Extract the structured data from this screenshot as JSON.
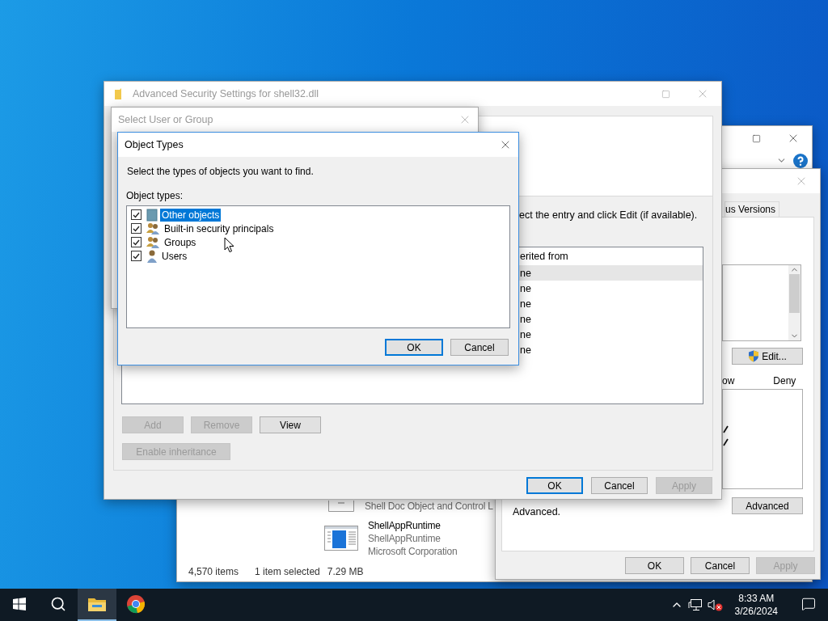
{
  "explorer": {
    "files": [
      {
        "description": "Shell Doc Object and Control L"
      },
      {
        "name": "ShellAppRuntime",
        "description": "ShellAppRuntime",
        "company": "Microsoft Corporation"
      }
    ],
    "status": {
      "count": "4,570 items",
      "selection": "1 item selected",
      "size": "7.29 MB"
    }
  },
  "properties": {
    "tabs": [
      {
        "label": "us Versions",
        "selected": false
      }
    ],
    "edit_button": "Edit...",
    "columns": [
      "ow",
      "Deny"
    ],
    "permissions": [
      {
        "checked": true
      },
      {
        "checked": true
      }
    ],
    "note": "Advanced.",
    "advanced_button": "Advanced",
    "buttons": [
      {
        "label": "OK",
        "disabled": false
      },
      {
        "label": "Cancel",
        "disabled": false
      },
      {
        "label": "Apply",
        "disabled": true
      }
    ]
  },
  "security_settings": {
    "title": "Advanced Security Settings for shell32.dll",
    "instruction": "ect the entry and click Edit (if available).",
    "column": "erited from",
    "rows": [
      {
        "cell": "ne",
        "selected": true
      },
      {
        "cell": "ne",
        "selected": false
      },
      {
        "cell": "ne",
        "selected": false
      },
      {
        "cell": "ne",
        "selected": false
      },
      {
        "cell": "ne",
        "selected": false
      },
      {
        "cell": "ne",
        "selected": false
      }
    ],
    "actions": [
      {
        "label": "Add",
        "disabled": true
      },
      {
        "label": "Remove",
        "disabled": true
      },
      {
        "label": "View",
        "disabled": false
      }
    ],
    "inheritance_button": {
      "label": "Enable inheritance",
      "disabled": true
    },
    "buttons": [
      {
        "label": "OK",
        "disabled": false,
        "default": true
      },
      {
        "label": "Cancel",
        "disabled": false,
        "default": false
      },
      {
        "label": "Apply",
        "disabled": true,
        "default": false
      }
    ]
  },
  "select_user": {
    "title": "Select User or Group"
  },
  "object_types": {
    "title": "Object Types",
    "instruction": "Select the types of objects you want to find.",
    "list_label": "Object types:",
    "items": [
      {
        "label": "Other objects",
        "kind": "object",
        "checked": true,
        "selected": true
      },
      {
        "label": "Built-in security principals",
        "kind": "group",
        "checked": true,
        "selected": false
      },
      {
        "label": "Groups",
        "kind": "group",
        "checked": true,
        "selected": false
      },
      {
        "label": "Users",
        "kind": "user",
        "checked": true,
        "selected": false
      }
    ],
    "buttons": [
      {
        "label": "OK",
        "default": true
      },
      {
        "label": "Cancel",
        "default": false
      }
    ]
  },
  "taskbar": {
    "apps": [
      {
        "kind": "explorer",
        "active": true
      },
      {
        "kind": "browser",
        "active": false
      }
    ],
    "time": "8:33 AM",
    "date": "3/26/2024"
  }
}
